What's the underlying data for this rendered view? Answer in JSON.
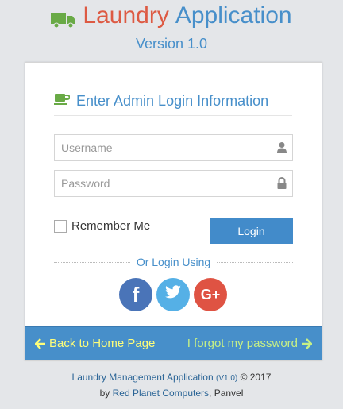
{
  "header": {
    "title_word1": "Laundry",
    "title_word2": "Application",
    "version": "Version 1.0"
  },
  "login": {
    "title": "Enter Admin Login Information",
    "username_placeholder": "Username",
    "password_placeholder": "Password",
    "remember_label": "Remember Me",
    "login_button": "Login",
    "or_text": "Or Login Using",
    "social": {
      "facebook": "f",
      "twitter": "t",
      "google": "G+"
    }
  },
  "links": {
    "back": "Back to Home Page",
    "forgot": "I forgot my password"
  },
  "footer": {
    "app_name": "Laundry Management Application",
    "version_tag": "(V1.0)",
    "copyright": "© 2017",
    "by": "by",
    "company": "Red Planet Computers",
    "location": ", Panvel"
  },
  "colors": {
    "primary": "#478fca",
    "brand_red": "#dd5a43",
    "link_yellow": "#fefe7a",
    "link_green": "#c6ef86"
  },
  "icons": [
    "truck-icon",
    "coffee-icon",
    "user-icon",
    "lock-icon",
    "facebook-icon",
    "twitter-icon",
    "google-plus-icon",
    "arrow-left-icon",
    "arrow-right-icon"
  ]
}
